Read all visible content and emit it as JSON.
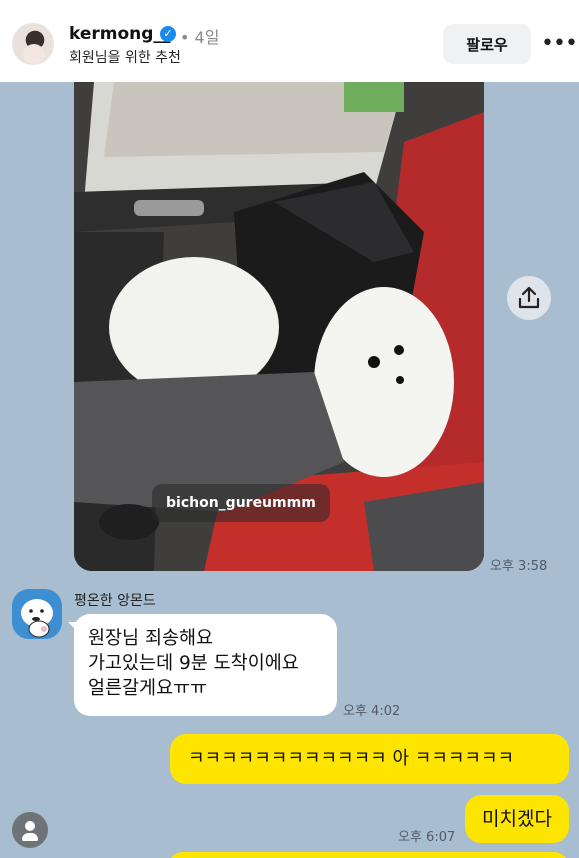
{
  "header": {
    "username": "kermong__",
    "verified_icon": "verified-badge-icon",
    "time_ago": "• 4일",
    "subtitle": "회원님을 위한 추천",
    "follow_label": "팔로우",
    "more_label": "•••"
  },
  "photo": {
    "tag": "bichon_gureummm",
    "timestamp": "오후 3:58"
  },
  "share_icon": "share-icon",
  "incoming": {
    "sender": "평온한 앙몬드",
    "lines": [
      "원장님 죄송해요",
      "가고있는데 9분 도착이에요",
      "얼른갈게요ㅠㅠ"
    ],
    "timestamp": "오후 4:02"
  },
  "outgoing": [
    {
      "text": "ㅋㅋㅋㅋㅋㅋㅋㅋㅋㅋㅋㅋ 아 ㅋㅋㅋㅋㅋㅋ"
    },
    {
      "text": "미치겠다",
      "timestamp": "오후 6:07"
    },
    {
      "text": ""
    }
  ],
  "colors": {
    "chat_background": "#a9bdd0",
    "outgoing_bubble": "#fee500",
    "incoming_bubble": "#ffffff",
    "verified": "#1a8cf0"
  }
}
